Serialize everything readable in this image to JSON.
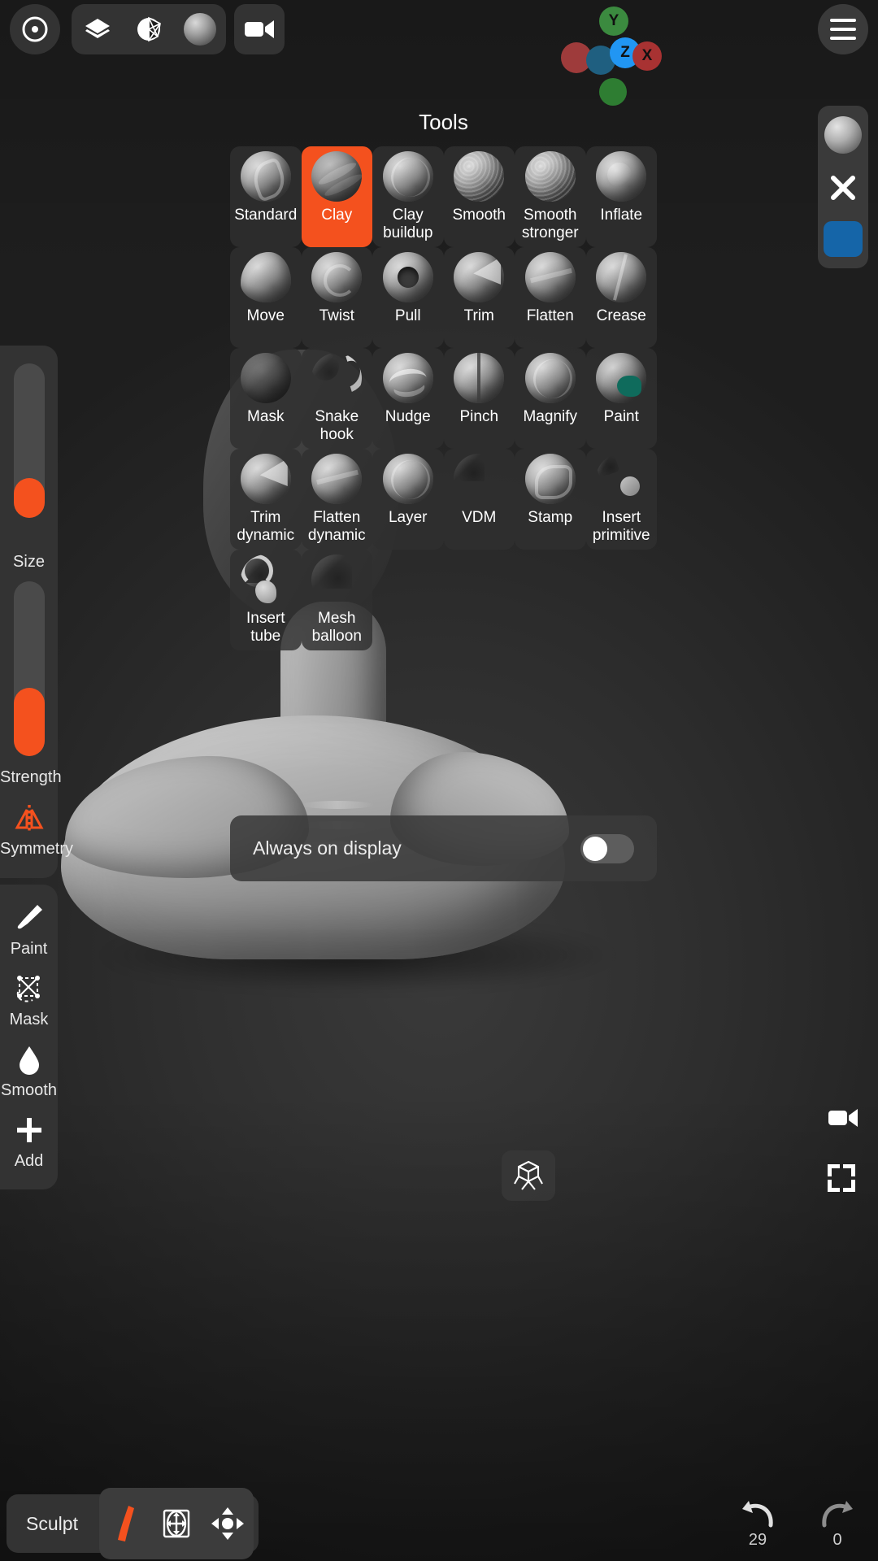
{
  "app": {
    "mode_label": "Sculpt"
  },
  "topbar": {
    "items": [
      {
        "name": "gizmo-target-icon",
        "label": "Gizmo"
      },
      {
        "name": "layers-icon",
        "label": "Layers"
      },
      {
        "name": "topology-icon",
        "label": "Topology"
      },
      {
        "name": "matcap-sphere-icon",
        "label": "Material"
      },
      {
        "name": "camera-icon",
        "label": "Camera"
      },
      {
        "name": "hamburger-menu-icon",
        "label": "Menu"
      }
    ]
  },
  "axis_gizmo": {
    "axes": [
      {
        "label": "Y",
        "color": "#3b8a3f",
        "x": 47,
        "y": 0,
        "size": 36,
        "text": true
      },
      {
        "label": "",
        "color": "#9e3b3b",
        "x": 0,
        "y": 44,
        "size": 38,
        "text": false
      },
      {
        "label": "",
        "color": "#1f5f80",
        "x": 31,
        "y": 48,
        "size": 36,
        "text": false
      },
      {
        "label": "Z",
        "color": "#2196f3",
        "x": 60,
        "y": 38,
        "size": 38,
        "text": true
      },
      {
        "label": "X",
        "color": "#a83232",
        "x": 88,
        "y": 43,
        "size": 36,
        "text": true
      },
      {
        "label": "",
        "color": "#2e7d32",
        "x": 47,
        "y": 88,
        "size": 34,
        "text": false
      }
    ]
  },
  "tools_panel": {
    "title": "Tools",
    "selected": "Clay",
    "accent_color": "#f4511e",
    "tools": [
      {
        "label": "Standard",
        "thumb": "t-swirl",
        "icon": "tool-standard-icon"
      },
      {
        "label": "Clay",
        "thumb": "t-clay",
        "icon": "tool-clay-icon"
      },
      {
        "label": "Clay\nbuildup",
        "thumb": "t-lines",
        "icon": "tool-clay-buildup-icon"
      },
      {
        "label": "Smooth",
        "thumb": "t-noise",
        "icon": "tool-smooth-icon"
      },
      {
        "label": "Smooth\nstronger",
        "thumb": "t-noise",
        "icon": "tool-smooth-stronger-icon"
      },
      {
        "label": "Inflate",
        "thumb": "t-bump",
        "icon": "tool-inflate-icon"
      },
      {
        "label": "Move",
        "thumb": "t-blob",
        "icon": "tool-move-icon"
      },
      {
        "label": "Twist",
        "thumb": "t-spiral",
        "icon": "tool-twist-icon"
      },
      {
        "label": "Pull",
        "thumb": "t-hole",
        "icon": "tool-pull-icon"
      },
      {
        "label": "Trim",
        "thumb": "t-wedge",
        "icon": "tool-trim-icon"
      },
      {
        "label": "Flatten",
        "thumb": "t-flat",
        "icon": "tool-flatten-icon"
      },
      {
        "label": "Crease",
        "thumb": "t-crease",
        "icon": "tool-crease-icon"
      },
      {
        "label": "Mask",
        "thumb": "t-mask",
        "icon": "tool-mask-icon"
      },
      {
        "label": "Snake\nhook",
        "thumb": "t-hook",
        "icon": "tool-snake-hook-icon"
      },
      {
        "label": "Nudge",
        "thumb": "t-wave",
        "icon": "tool-nudge-icon"
      },
      {
        "label": "Pinch",
        "thumb": "t-split",
        "icon": "tool-pinch-icon"
      },
      {
        "label": "Magnify",
        "thumb": "t-lines",
        "icon": "tool-magnify-icon"
      },
      {
        "label": "Paint",
        "thumb": "t-paint",
        "icon": "tool-paint-icon"
      },
      {
        "label": "Trim\ndynamic",
        "thumb": "t-wedge",
        "icon": "tool-trim-dynamic-icon"
      },
      {
        "label": "Flatten\ndynamic",
        "thumb": "t-flat",
        "icon": "tool-flatten-dynamic-icon"
      },
      {
        "label": "Layer",
        "thumb": "t-lines",
        "icon": "tool-layer-icon"
      },
      {
        "label": "VDM",
        "thumb": "t-vdm",
        "icon": "tool-vdm-icon"
      },
      {
        "label": "Stamp",
        "thumb": "t-stamp",
        "icon": "tool-stamp-icon"
      },
      {
        "label": "Insert\nprimitive",
        "thumb": "t-prim",
        "icon": "tool-insert-primitive-icon"
      },
      {
        "label": "Insert\ntube",
        "thumb": "t-tube",
        "icon": "tool-insert-tube-icon"
      },
      {
        "label": "Mesh\nballoon",
        "thumb": "t-balloon",
        "icon": "tool-mesh-balloon-icon"
      }
    ],
    "always_on_display": {
      "label": "Always on display",
      "enabled": false
    }
  },
  "left_sidebar": {
    "sliders": [
      {
        "label": "Size",
        "fill_percent": 26
      },
      {
        "label": "Strength",
        "fill_percent": 39
      }
    ],
    "symmetry": {
      "label": "Symmetry",
      "icon": "symmetry-icon",
      "active": true
    },
    "brushes": [
      {
        "label": "Paint",
        "icon": "paintbrush-icon"
      },
      {
        "label": "Mask",
        "icon": "mask-lasso-icon"
      },
      {
        "label": "Smooth",
        "icon": "droplet-icon"
      },
      {
        "label": "Add",
        "icon": "plus-icon"
      }
    ]
  },
  "right_sidebar": {
    "items": [
      {
        "name": "matcap-preview-icon",
        "label": "Matcap"
      },
      {
        "name": "close-x-icon",
        "label": "Close"
      },
      {
        "name": "color-swatch",
        "label": "Color",
        "color": "#1565a8"
      }
    ]
  },
  "viewport_controls": {
    "cube_button": {
      "name": "cube-gizmo-icon",
      "label": "View cube"
    },
    "record_button": {
      "name": "camera-record-icon",
      "label": "Record"
    },
    "fullscreen_button": {
      "name": "fullscreen-icon",
      "label": "Fullscreen"
    }
  },
  "bottom_bar": {
    "mode_label": "Sculpt",
    "mode_buttons": [
      {
        "name": "brush-stroke-icon",
        "label": "Brush",
        "active": true
      },
      {
        "name": "transform-gizmo-icon",
        "label": "Transform",
        "active": false
      },
      {
        "name": "move-pad-icon",
        "label": "Move",
        "active": false
      }
    ],
    "undo": {
      "label": "Undo",
      "count": "29",
      "icon": "undo-arrow-icon"
    },
    "redo": {
      "label": "Redo",
      "count": "0",
      "icon": "redo-arrow-icon"
    }
  }
}
